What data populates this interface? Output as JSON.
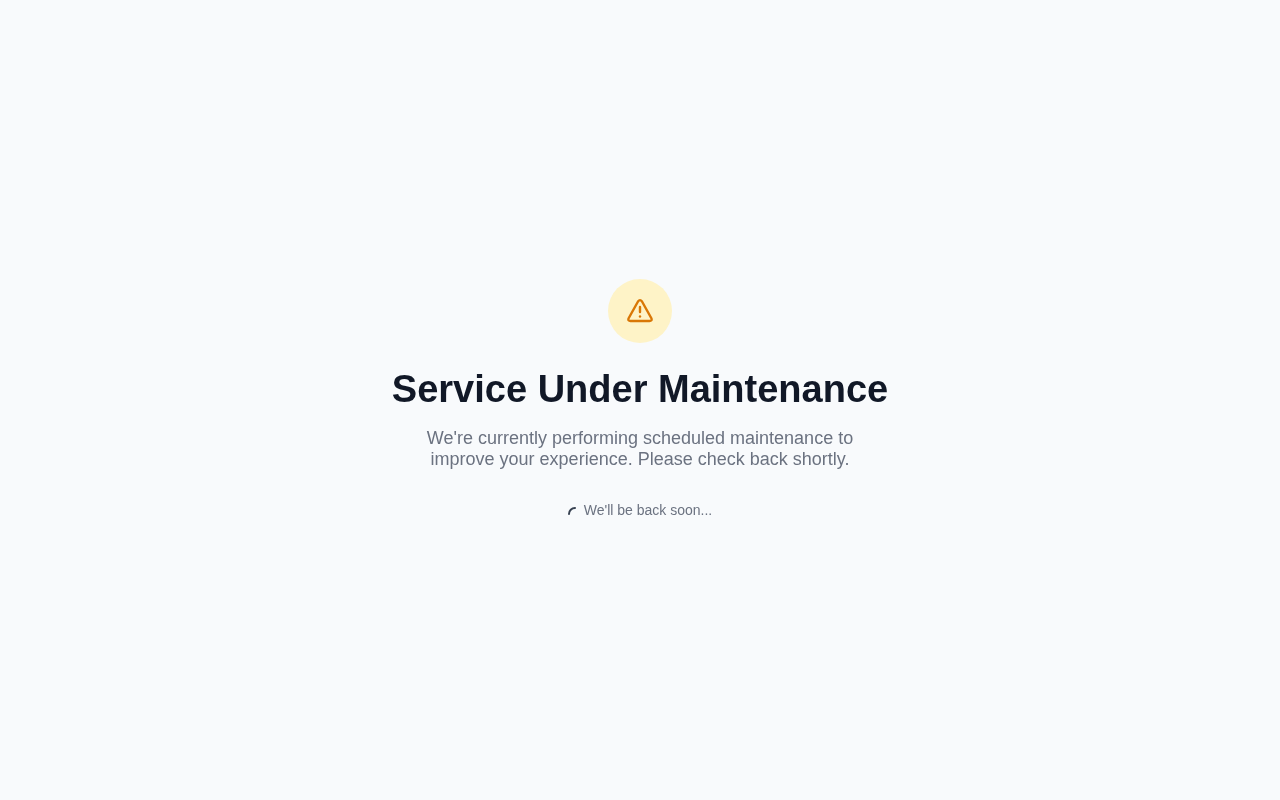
{
  "title": "Service Under Maintenance",
  "message": "We're currently performing scheduled maintenance to improve your experience. Please check back shortly.",
  "status": "We'll be back soon..."
}
